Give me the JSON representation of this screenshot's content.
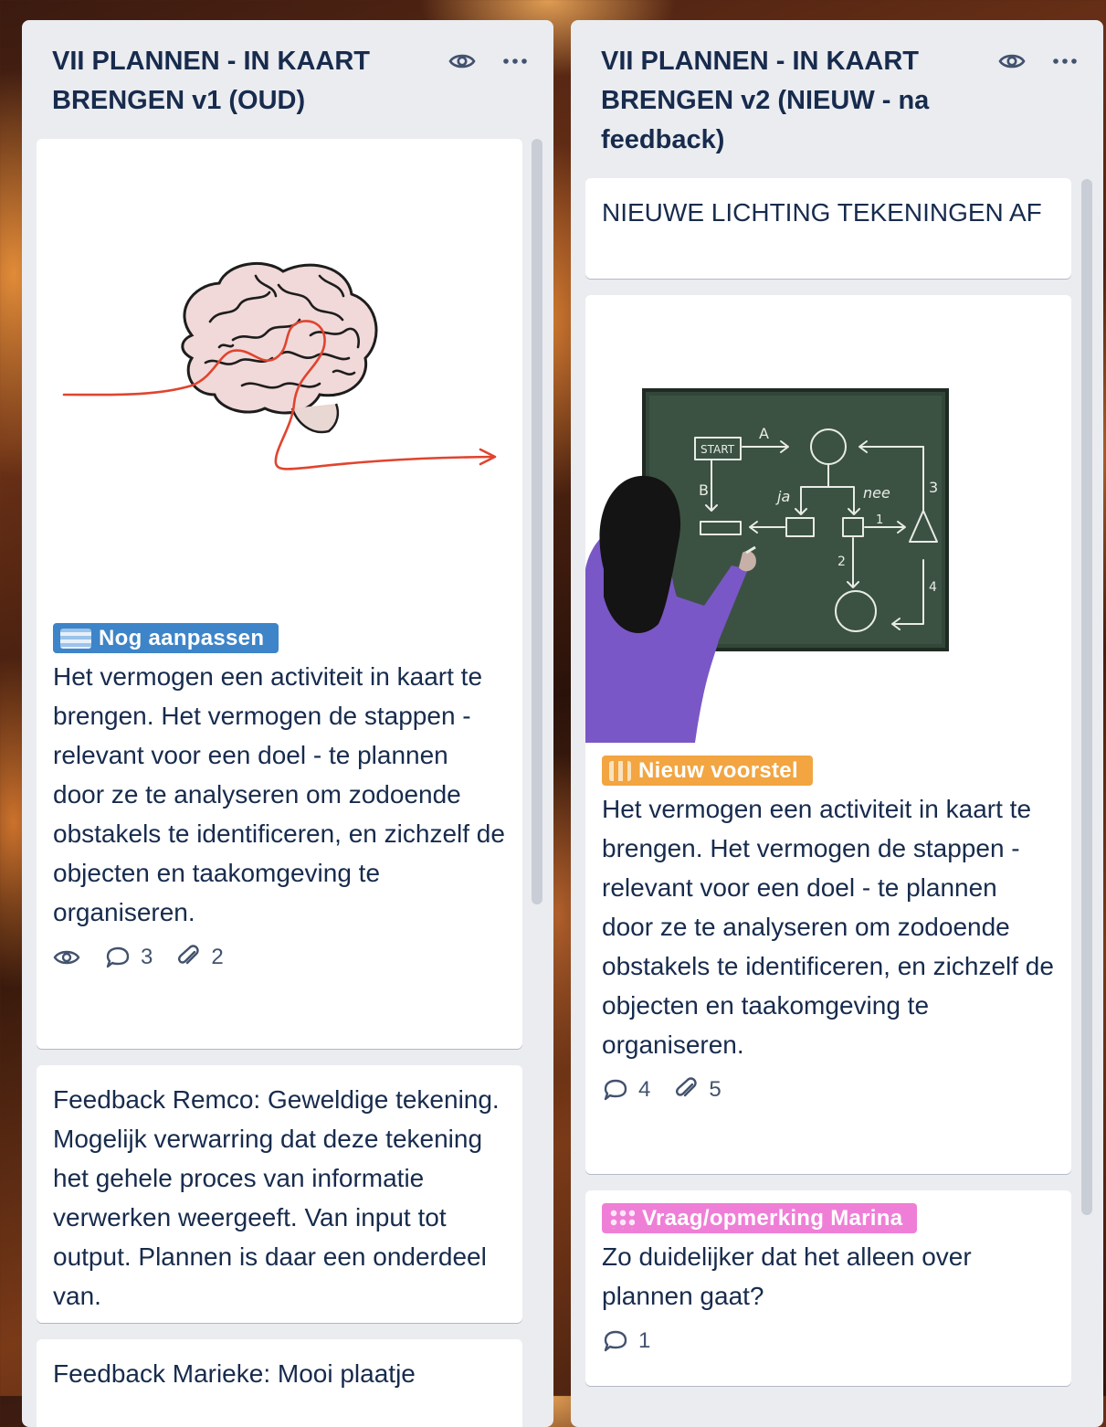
{
  "lists": [
    {
      "title": "VII PLANNEN - IN KAART BRENGEN v1 (OUD)",
      "cards": [
        {
          "label": "Nog aanpassen",
          "label_color": "#3e84c8",
          "text": "Het vermogen een activiteit in kaart te brengen. Het vermogen de stappen - relevant voor een doel - te plannen door ze te analyseren om zodoende obstakels te identificeren, en zichzelf de objecten en taakomgeving te organiseren.",
          "comments": "3",
          "attachments": "2"
        },
        {
          "text": "Feedback Remco: Geweldige tekening. Mogelijk verwarring dat deze tekening het gehele proces van informatie verwerken weergeeft. Van input tot output. Plannen is daar een onderdeel van."
        },
        {
          "text": "Feedback Marieke: Mooi plaatje"
        }
      ]
    },
    {
      "title": "VII PLANNEN - IN KAART BRENGEN v2 (NIEUW - na feedback)",
      "cards": [
        {
          "text": "NIEUWE LICHTING TEKENINGEN AF"
        },
        {
          "label": "Nieuw voorstel",
          "label_color": "#f2a541",
          "drawing": {
            "start": "START",
            "a": "A",
            "b": "B",
            "ja": "ja",
            "nee": "nee",
            "n1": "1",
            "n2": "2",
            "n3": "3",
            "n4": "4"
          },
          "text": "Het vermogen een activiteit in kaart te brengen. Het vermogen de stappen - relevant voor een doel - te plannen door ze te analyseren om zodoende obstakels te identificeren, en zichzelf de objecten en taakomgeving te organiseren.",
          "comments": "4",
          "attachments": "5"
        },
        {
          "label": "Vraag/opmerking Marina",
          "label_color": "#ef7fd6",
          "text": "Zo duidelijker dat het alleen over plannen gaat?",
          "comments": "1"
        }
      ]
    }
  ]
}
